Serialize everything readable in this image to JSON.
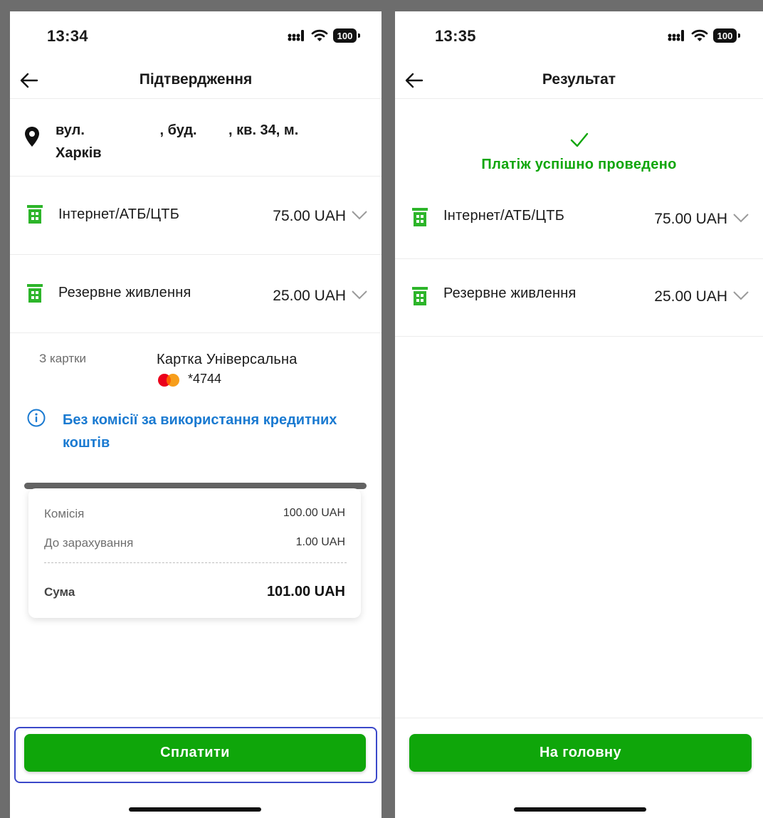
{
  "left": {
    "status": {
      "time": "13:34",
      "battery": "100"
    },
    "header": {
      "title": "Підтвердження"
    },
    "address": "вул.                   , буд.        , кв. 34, м. Харків",
    "services": [
      {
        "name": "Інтернет/АТБ/ЦТБ",
        "amount": "75.00 UAH"
      },
      {
        "name": "Резервне живлення",
        "amount": "25.00 UAH"
      }
    ],
    "card": {
      "label": "З картки",
      "name": "Картка Універсальна",
      "number": "*4744"
    },
    "commission_note": "Без комісії за використання кредитних коштів",
    "summary": {
      "commission_label": "Комісія",
      "commission_value": "100.00 UAH",
      "credited_label": "До зарахування",
      "credited_value": "1.00 UAH",
      "total_label": "Сума",
      "total_value": "101.00 UAH"
    },
    "pay_button": "Сплатити"
  },
  "right": {
    "status": {
      "time": "13:35",
      "battery": "100"
    },
    "header": {
      "title": "Результат"
    },
    "success": "Платіж успішно проведено",
    "services": [
      {
        "name": "Інтернет/АТБ/ЦТБ",
        "amount": "75.00 UAH"
      },
      {
        "name": "Резервне живлення",
        "amount": "25.00 UAH"
      }
    ],
    "home_button": "На головну"
  },
  "colors": {
    "accent_green": "#0fa60a",
    "link_blue": "#1a7ad1",
    "focus_frame": "#3b48c9"
  }
}
